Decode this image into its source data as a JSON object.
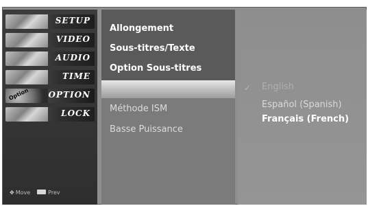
{
  "tabs": [
    {
      "label": "SETUP"
    },
    {
      "label": "VIDEO"
    },
    {
      "label": "AUDIO"
    },
    {
      "label": "TIME"
    },
    {
      "label": "OPTION",
      "icon_text": "Option"
    },
    {
      "label": "LOCK"
    }
  ],
  "footer": {
    "move_label": "Move",
    "prev_label": "Prev"
  },
  "menu": {
    "items": [
      "Allongement",
      "Sous-titres/Texte",
      "Option Sous-titres",
      "Méthode ISM",
      "Basse Puissance"
    ]
  },
  "submenu": {
    "check_glyph": "✓",
    "options": [
      "English",
      "Español (Spanish)",
      "Français (French)"
    ]
  }
}
